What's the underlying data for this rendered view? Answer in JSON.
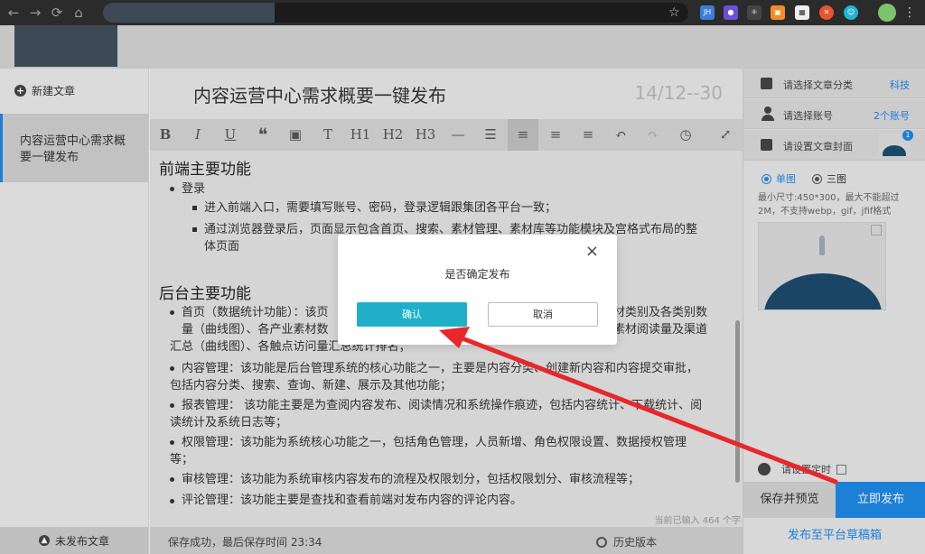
{
  "browser": {
    "nav": [
      "←",
      "→",
      "⟳",
      "⌂"
    ],
    "star": "☆",
    "extensions": [
      {
        "label": "JH",
        "color": "#3b7dd8"
      },
      {
        "label": "●",
        "color": "#6b4fd8"
      },
      {
        "label": "⚛",
        "color": "#444444"
      },
      {
        "label": "▣",
        "color": "#f28c28"
      },
      {
        "label": "▦",
        "color": "#eeeeee"
      },
      {
        "label": "✕",
        "color": "#e8542e"
      },
      {
        "label": "☺",
        "color": "#20b3d6"
      }
    ],
    "menu": "⋮"
  },
  "sidebar": {
    "new_article": "新建文章",
    "new_article_icon": "plus-circle-icon",
    "article_title": "内容运营中心需求概要一键发布",
    "unpublished": "未发布文章"
  },
  "editor": {
    "title": "内容运营中心需求概要一键发布",
    "date": "14/12--30",
    "toolbar": [
      "B",
      "I",
      "U",
      "❝",
      "▣",
      "T",
      "H1",
      "H2",
      "H3",
      "—",
      "☰",
      "≡",
      "≡",
      "≡",
      "↶",
      "↷",
      "◷",
      "⤢"
    ],
    "section1": "前端主要功能",
    "s1_item1": "登录",
    "s1_sub1": "进入前端入口，需要填写账号、密码，登录逻辑跟集团各平台一致；",
    "s1_sub2_line1": "通过浏览器登录后，页面显示包含首页、搜索、素材管理、素材库等功能模块及宫格式布局的整",
    "s1_sub2_line2": "体页面",
    "section2": "后台主要功能",
    "s2_item1_a": "首页（数据统计功能）：该页",
    "s2_item1_b": "材类别及各类别数",
    "s2_item1_c": "量（曲线图）、各产业素材数",
    "s2_item1_d": "素材阅读量及渠道",
    "s2_item1_e": "汇总（曲线图）、各触点访问量汇总统计排名；",
    "s2_item2_a": "内容管理：该功能是后台管理系统的核心功能之一，主要是内容分类、创建新内容和内容提交审批，",
    "s2_item2_b": "包括内容分类、搜索、查询、新建、展示及其他功能；",
    "s2_item3_a": "报表管理：  该功能主要是为查阅内容发布、阅读情况和系统操作痕迹，包括内容统计、下载统计、阅",
    "s2_item3_b": "读统计及系统日志等；",
    "s2_item4_a": "权限管理：该功能为系统核心功能之一，包括角色管理，人员新增、角色权限设置、数据授权管理",
    "s2_item4_b": "等；",
    "s2_item5": "审核管理：该功能为系统审核内容发布的流程及权限划分，包括权限划分、审核流程等；",
    "s2_item6": "评论管理：该功能主要是查找和查看前端对发布内容的评论内容。",
    "char_count": "当前已输入 464 个字",
    "save_status": "保存成功，最后保存时间 23:34",
    "history": "历史版本"
  },
  "right_panel": {
    "category_label": "请选择文章分类",
    "category_value": "科技",
    "account_label": "请选择账号",
    "account_value": "2个账号",
    "cover_label": "请设置文章封面",
    "cover_badge": "1",
    "radio_single": "单图",
    "radio_triple": "三图",
    "hint": "最小尺寸:450*300，最大不能超过2M，不支持webp，gif，jfif格式",
    "schedule": "请设置定时",
    "preview": "保存并预览",
    "publish": "立即发布",
    "draft": "发布至平台草稿箱"
  },
  "modal": {
    "message": "是否确定发布",
    "confirm": "确认",
    "cancel": "取消",
    "close": "×"
  },
  "colors": {
    "accent": "#1e88e5",
    "confirm": "#1fb0c8",
    "arrow": "#e8272a"
  }
}
